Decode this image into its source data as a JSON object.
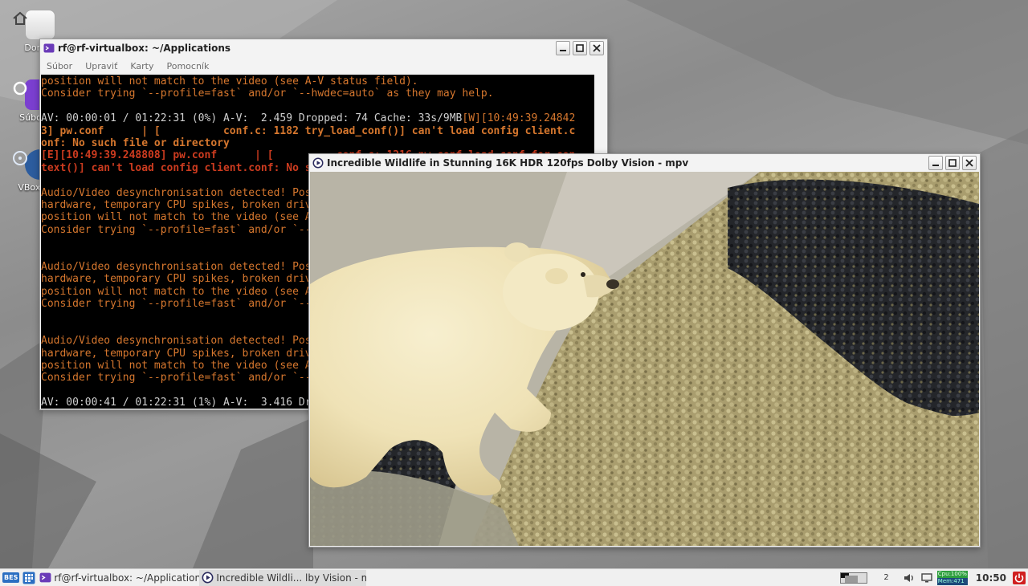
{
  "desktop": {
    "icons": [
      {
        "label": "Domov",
        "icon": "home-icon"
      },
      {
        "label": "Súborový",
        "icon": "file-manager-icon"
      },
      {
        "label": "VBox_GAs",
        "icon": "disc-icon"
      }
    ]
  },
  "terminal": {
    "title": "rf@rf-virtualbox: ~/Applications",
    "menu": [
      "Súbor",
      "Upraviť",
      "Karty",
      "Pomocník"
    ],
    "lines": [
      {
        "text": "position will not match to the video (see A-V status field).",
        "style": "orange"
      },
      {
        "text": "Consider trying `--profile=fast` and/or `--hwdec=auto` as they may help.",
        "style": "orange"
      },
      {
        "text": "",
        "style": "grey"
      },
      {
        "text": "AV: 00:00:01 / 01:22:31 (0%) A-V:  2.459 Dropped: 74 Cache: 33s/9MB",
        "style": "grey",
        "tail": "[W][10:49:39.24842",
        "tail_style": "orange"
      },
      {
        "text": "3] pw.conf      | [          conf.c: 1182 try_load_conf()] can't load config client.c",
        "style": "orange-bold"
      },
      {
        "text": "onf: No such file or directory",
        "style": "orange-bold"
      },
      {
        "text": "[E][10:49:39.248808] pw.conf      | [          conf.c: 1216 pw_conf_load_conf_for_con",
        "style": "red-bold"
      },
      {
        "text": "text()] can't load config client.conf: No such file or directory",
        "style": "red-bold"
      },
      {
        "text": "",
        "style": "grey"
      },
      {
        "text": "Audio/Video desynchronisation detected! Possible reasons include too slow",
        "style": "orange"
      },
      {
        "text": "hardware, temporary CPU spikes, broken drivers, and broken files. Audio",
        "style": "orange"
      },
      {
        "text": "position will not match to the video (see A-V status field).",
        "style": "orange"
      },
      {
        "text": "Consider trying `--profile=fast` and/or `--hwdec=auto` as they may help.",
        "style": "orange"
      },
      {
        "text": "",
        "style": "grey"
      },
      {
        "text": "",
        "style": "grey"
      },
      {
        "text": "Audio/Video desynchronisation detected! Possible reasons include too slow",
        "style": "orange"
      },
      {
        "text": "hardware, temporary CPU spikes, broken drivers, and broken files. Audio",
        "style": "orange"
      },
      {
        "text": "position will not match to the video (see A-V status field).",
        "style": "orange"
      },
      {
        "text": "Consider trying `--profile=fast` and/or `--hwdec=auto` as they may help.",
        "style": "orange"
      },
      {
        "text": "",
        "style": "grey"
      },
      {
        "text": "",
        "style": "grey"
      },
      {
        "text": "Audio/Video desynchronisation detected! Possible reasons include too slow",
        "style": "orange"
      },
      {
        "text": "hardware, temporary CPU spikes, broken drivers, and broken files. Audio",
        "style": "orange"
      },
      {
        "text": "position will not match to the video (see A-V status field).",
        "style": "orange"
      },
      {
        "text": "Consider trying `--profile=fast` and/or `--hwdec=auto` as they may help.",
        "style": "orange"
      },
      {
        "text": "",
        "style": "grey"
      },
      {
        "text": "AV: 00:00:41 / 01:22:31 (1%) A-V:  3.416 Dropped: 1190 Cache: 30s/8MB",
        "style": "grey"
      }
    ]
  },
  "mpv": {
    "title": "Incredible Wildlife in Stunning 16K HDR 120fps Dolby Vision - mpv"
  },
  "taskbar": {
    "menu_label": "BES",
    "tasks": [
      {
        "label": "rf@rf-virtualbox: ~/Applications",
        "icon": "terminal-icon",
        "active": false
      },
      {
        "label": "Incredible Wildli... lby Vision - mpv",
        "icon": "mpv-icon",
        "active": true
      }
    ],
    "workspace": "2",
    "sysmon": {
      "cpu": "Cpu:100%",
      "mem": "Mem:471"
    },
    "clock": "10:50"
  },
  "colors": {
    "terminal_orange": "#d6772e",
    "terminal_red": "#cc3b1f",
    "terminal_text": "#cfcfcf",
    "sysmon_green": "#2e9e3e",
    "power_red": "#d02020"
  }
}
